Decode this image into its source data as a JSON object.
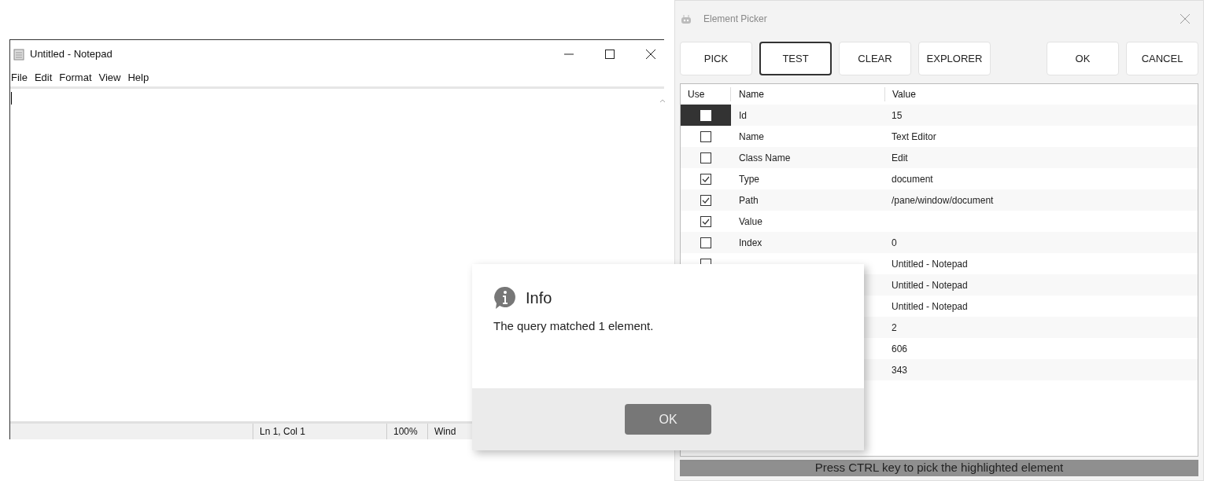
{
  "notepad": {
    "title": "Untitled - Notepad",
    "menu": [
      "File",
      "Edit",
      "Format",
      "View",
      "Help"
    ],
    "status": [
      "Ln 1, Col 1",
      "100%",
      "Wind"
    ]
  },
  "picker": {
    "title": "Element Picker",
    "buttons": [
      {
        "label": "PICK",
        "selected": false
      },
      {
        "label": "TEST",
        "selected": true
      },
      {
        "label": "CLEAR",
        "selected": false
      },
      {
        "label": "EXPLORER",
        "selected": false
      },
      {
        "label": "OK",
        "selected": false
      },
      {
        "label": "CANCEL",
        "selected": false
      }
    ],
    "columns": [
      "Use",
      "Name",
      "Value"
    ],
    "rows": [
      {
        "checked": false,
        "selected": true,
        "name": "Id",
        "value": "15"
      },
      {
        "checked": false,
        "selected": false,
        "name": "Name",
        "value": "Text Editor"
      },
      {
        "checked": false,
        "selected": false,
        "name": "Class Name",
        "value": "Edit"
      },
      {
        "checked": true,
        "selected": false,
        "name": "Type",
        "value": "document"
      },
      {
        "checked": true,
        "selected": false,
        "name": "Path",
        "value": "/pane/window/document"
      },
      {
        "checked": true,
        "selected": false,
        "name": "Value"
      },
      {
        "checked": false,
        "selected": false,
        "name": "Index",
        "value": "0"
      },
      {
        "checked": false,
        "selected": false,
        "value": "Untitled - Notepad"
      },
      {
        "value": "Untitled - Notepad"
      },
      {
        "value": "Untitled - Notepad"
      },
      {
        "value": "2"
      },
      {
        "value": "606"
      },
      {
        "value": "343"
      }
    ],
    "status": "Press CTRL key to pick the highlighted element"
  },
  "dialog": {
    "title": "Info",
    "message": "The query matched 1 element.",
    "button": "OK"
  }
}
